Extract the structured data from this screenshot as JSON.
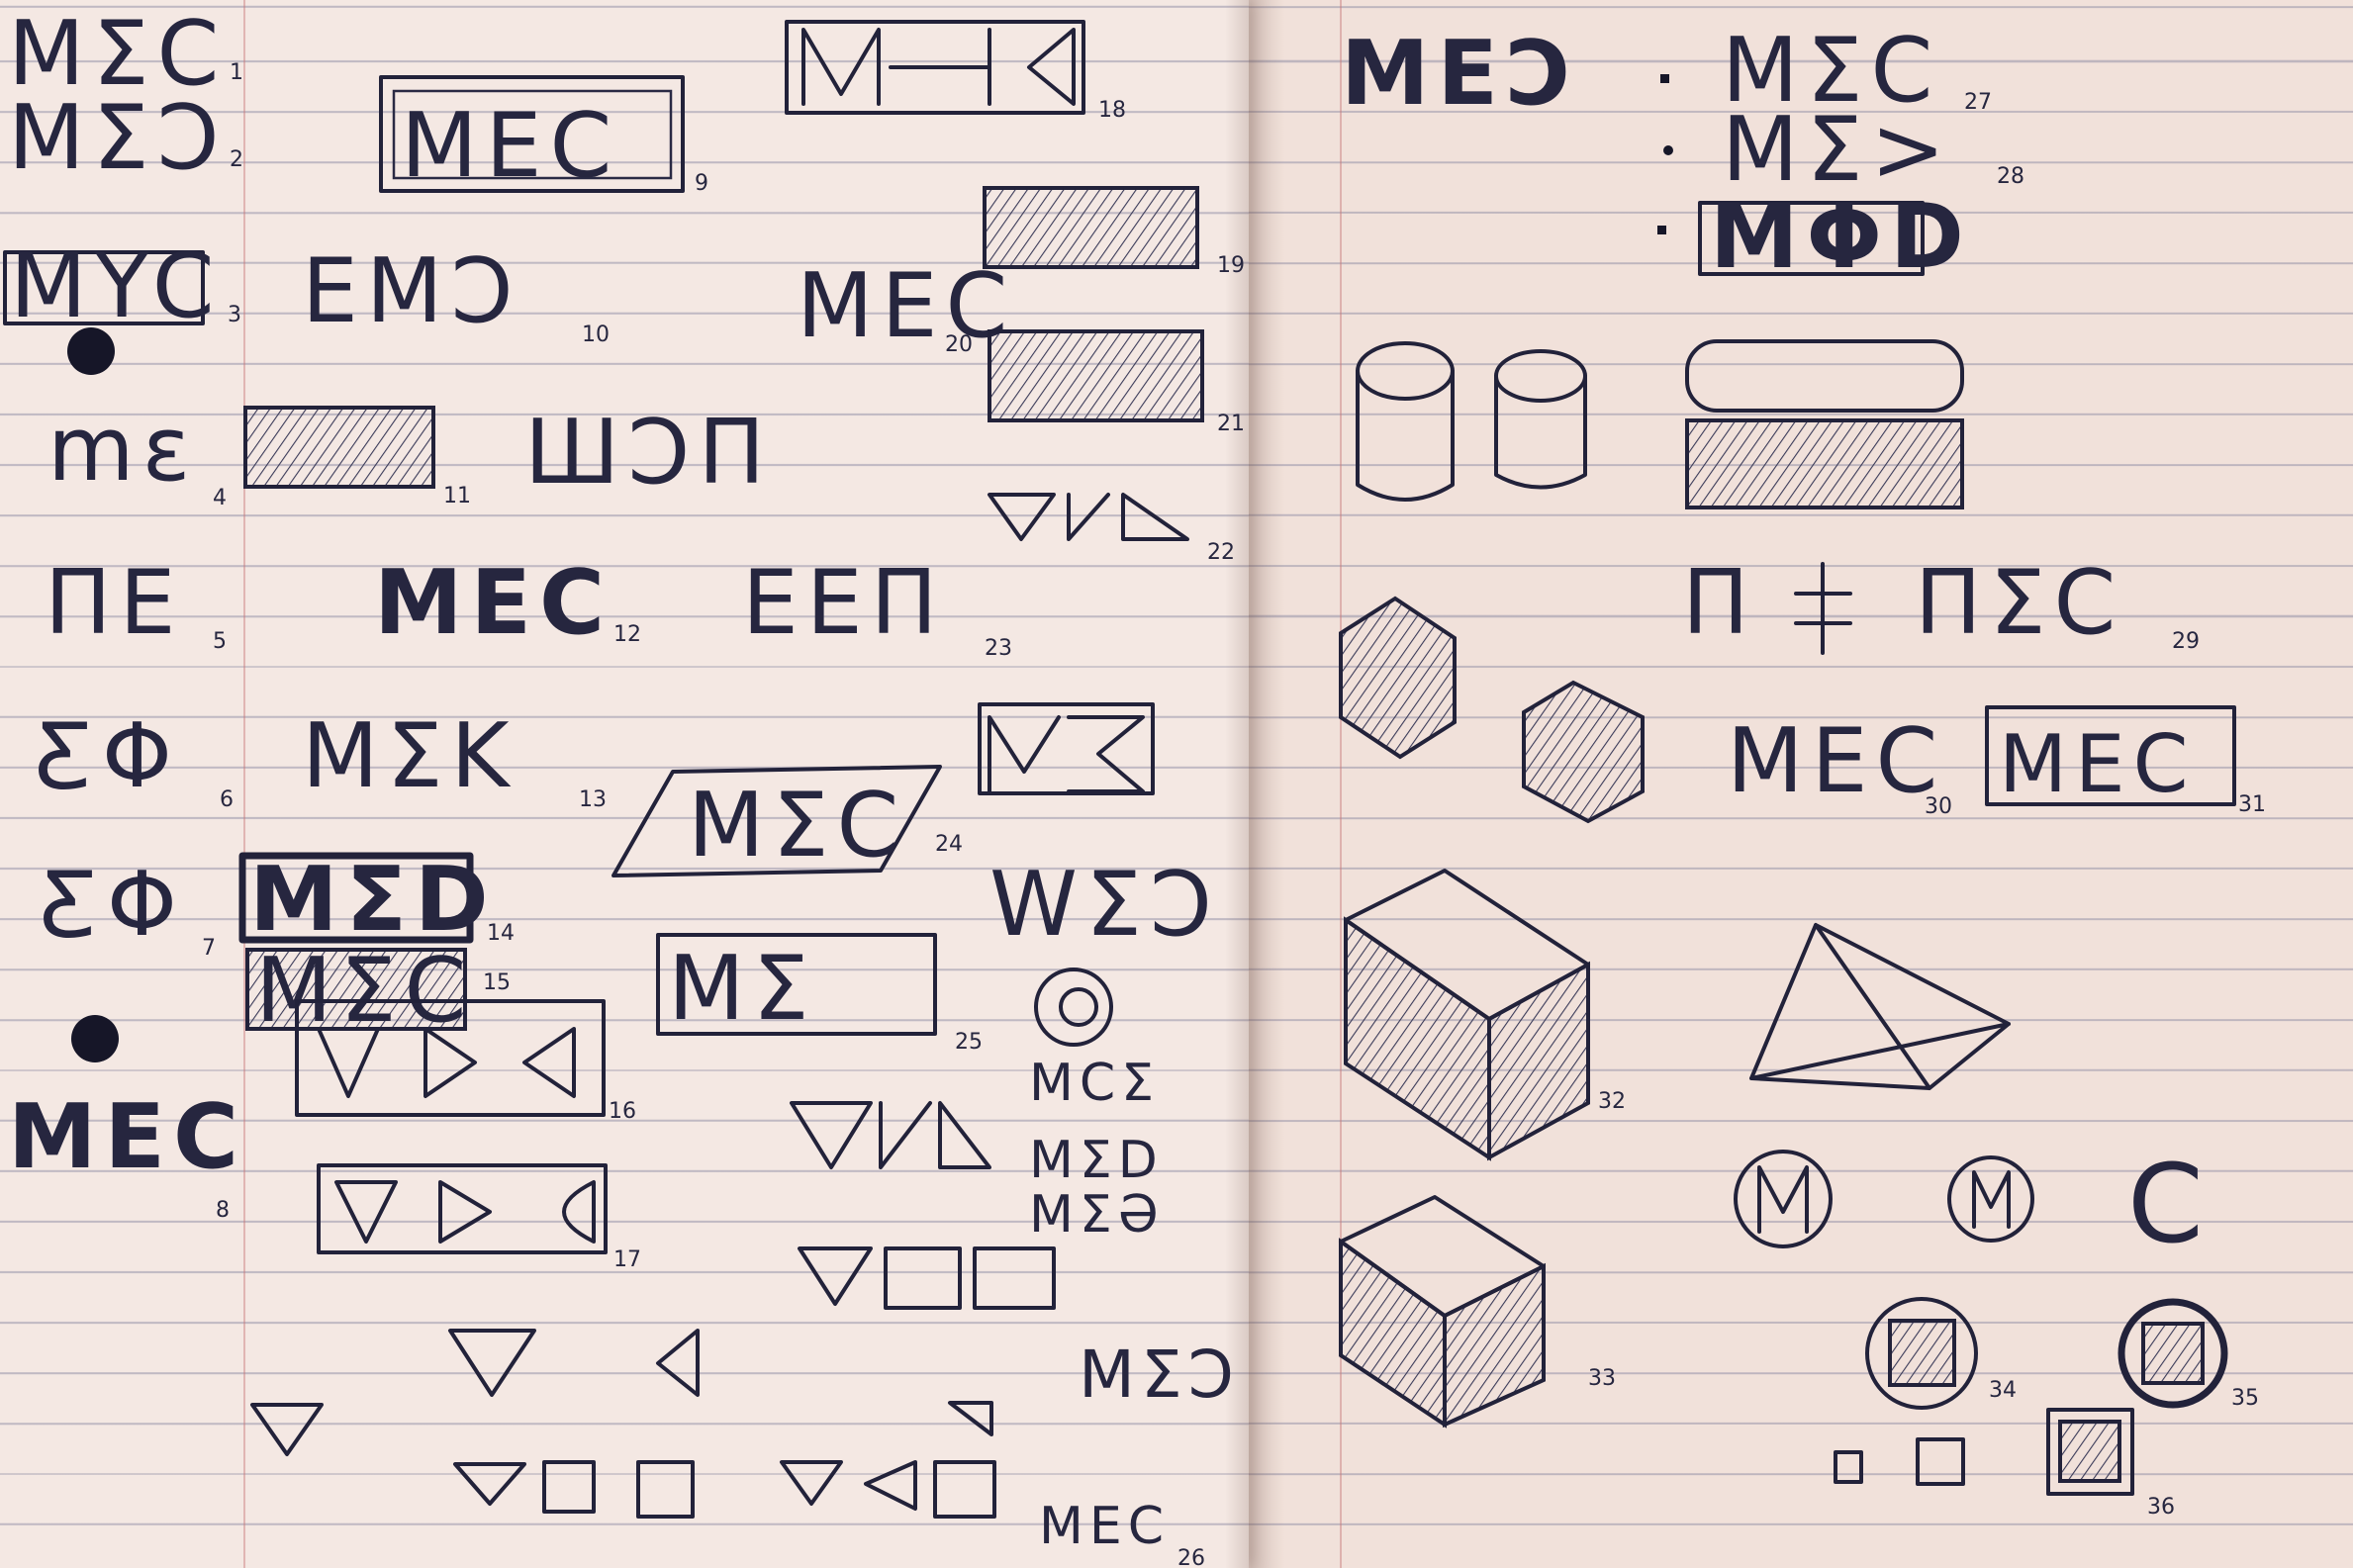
{
  "sketches_left": [
    {
      "num": "1",
      "text": "MΣC"
    },
    {
      "num": "2",
      "text": "MΣƆ"
    },
    {
      "num": "3",
      "text": "MYC"
    },
    {
      "num": "4",
      "text": "mε"
    },
    {
      "num": "5",
      "text": "ΠE"
    },
    {
      "num": "6",
      "text": "ƸΦ"
    },
    {
      "num": "7",
      "text": "ƸΦ"
    },
    {
      "num": "8",
      "text": "MEC"
    },
    {
      "num": "9",
      "text": "MEC"
    },
    {
      "num": "10",
      "text": "EMƆ"
    },
    {
      "num": "11",
      "text": "ШƆП"
    },
    {
      "num": "12",
      "text": "MEC"
    },
    {
      "num": "13",
      "text": "MΣK"
    },
    {
      "num": "14",
      "text": "MΣD"
    },
    {
      "num": "15",
      "text": "MΣC"
    },
    {
      "num": "16",
      "text": ""
    },
    {
      "num": "17",
      "text": ""
    },
    {
      "num": "18",
      "text": ""
    },
    {
      "num": "19",
      "text": ""
    },
    {
      "num": "20",
      "text": "MEC"
    },
    {
      "num": "21",
      "text": ""
    },
    {
      "num": "22",
      "text": ""
    },
    {
      "num": "23",
      "text": "EEП"
    },
    {
      "num": "24",
      "text": "MΣC"
    },
    {
      "num": "25",
      "text": "MΣ"
    },
    {
      "num": "26",
      "text": "MEC"
    }
  ],
  "extra_left": [
    {
      "text": "WΣƆ"
    },
    {
      "text": "MCΣ"
    },
    {
      "text": "MΣD"
    },
    {
      "text": "MΣƏ"
    },
    {
      "text": "MΣƆ"
    }
  ],
  "sketches_right": [
    {
      "num": "27",
      "text": "MΣC"
    },
    {
      "num": "28",
      "text": "MΣ>"
    },
    {
      "num": "29",
      "text": "ΠΣC"
    },
    {
      "num": "30",
      "text": "MEC"
    },
    {
      "num": "31",
      "text": "MEC"
    },
    {
      "num": "32",
      "text": ""
    },
    {
      "num": "33",
      "text": ""
    },
    {
      "num": "34",
      "text": ""
    },
    {
      "num": "35",
      "text": ""
    },
    {
      "num": "36",
      "text": ""
    }
  ],
  "extra_right": [
    {
      "text": "MEƆ"
    },
    {
      "text": "MΦD"
    },
    {
      "text": "C"
    }
  ]
}
